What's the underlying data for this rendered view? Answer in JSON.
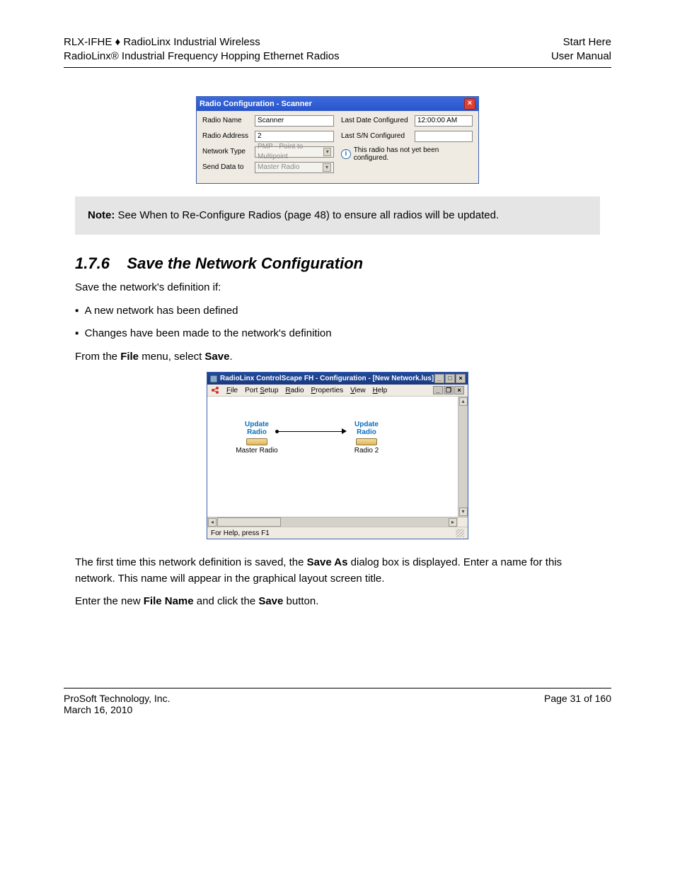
{
  "header": {
    "left_line1": "RLX-IFHE ♦ RadioLinx Industrial Wireless",
    "left_line2": "RadioLinx® Industrial Frequency Hopping Ethernet Radios",
    "right_line1": "Start Here",
    "right_line2": "User Manual"
  },
  "dialog1": {
    "title": "Radio Configuration - Scanner",
    "labels": {
      "radio_name": "Radio Name",
      "radio_address": "Radio Address",
      "network_type": "Network Type",
      "send_data_to": "Send Data to",
      "last_date": "Last Date Configured",
      "last_sn": "Last S/N Configured"
    },
    "values": {
      "radio_name": "Scanner",
      "radio_address": "2",
      "network_type": "PMP - Point to Multipoint",
      "send_data_to": "Master Radio",
      "last_date": "12:00:00 AM",
      "last_sn": ""
    },
    "info_text": "This radio has not yet been configured."
  },
  "note": {
    "label": "Note:",
    "text": " See When to Re-Configure Radios (page 48) to ensure all radios will be updated."
  },
  "section": {
    "number": "1.7.6",
    "title": "Save the Network Configuration",
    "para": "Save the network's definition if:",
    "bullet1": "A new network has been defined",
    "bullet2": "Changes have been made to the network's definition",
    "menu_instr_prefix": "From the ",
    "menu_instr_mid": " menu, select ",
    "menu_file": "File",
    "menu_save": "Save"
  },
  "dialog2": {
    "title": "RadioLinx ControlScape FH - Configuration - [New Network.lus]",
    "menus": [
      "File",
      "Port Setup",
      "Radio",
      "Properties",
      "View",
      "Help"
    ],
    "node1": {
      "update": "Update",
      "radio": "Radio",
      "caption": "Master Radio"
    },
    "node2": {
      "update": "Update",
      "radio": "Radio",
      "caption": "Radio 2"
    },
    "status": "For Help, press F1"
  },
  "after": {
    "p1_prefix": "The first time this network definition is saved, the ",
    "p1_strong": "Save As",
    "p1_suffix": " dialog box is displayed. Enter a name for this network. This name will appear in the graphical layout screen title.",
    "p2_prefix": "Enter the new ",
    "p2_strong": "File Name",
    "p2_mid": " and click the ",
    "p2_strong2": "Save",
    "p2_suffix": " button."
  },
  "footer": {
    "left": "ProSoft Technology, Inc.",
    "right": "Page 31 of 160",
    "date": "March 16, 2010"
  }
}
